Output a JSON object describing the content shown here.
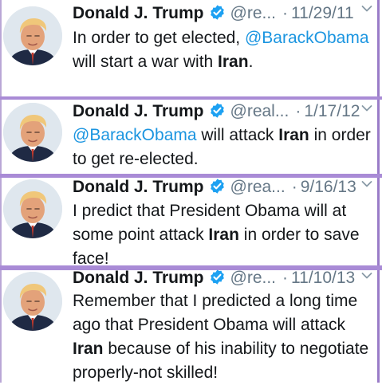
{
  "tweets": [
    {
      "name": "Donald J. Trump",
      "handle": "@re...",
      "date": "11/29/11",
      "text": [
        {
          "t": "In order to get elected, ",
          "s": "n"
        },
        {
          "t": "@BarackObama",
          "s": "m"
        },
        {
          "t": " will start a war with ",
          "s": "n"
        },
        {
          "t": "Iran",
          "s": "b"
        },
        {
          "t": ".",
          "s": "n"
        }
      ]
    },
    {
      "name": "Donald J. Trump",
      "handle": "@real...",
      "date": "1/17/12",
      "text": [
        {
          "t": "@BarackObama",
          "s": "m"
        },
        {
          "t": " will attack ",
          "s": "n"
        },
        {
          "t": "Iran",
          "s": "b"
        },
        {
          "t": " in order to get re-elected.",
          "s": "n"
        }
      ]
    },
    {
      "name": "Donald J. Trump",
      "handle": "@rea...",
      "date": "9/16/13",
      "text": [
        {
          "t": "I predict that President Obama will at some point attack ",
          "s": "n"
        },
        {
          "t": "Iran",
          "s": "b"
        },
        {
          "t": " in order to save face!",
          "s": "n"
        }
      ]
    },
    {
      "name": "Donald J. Trump",
      "handle": "@re...",
      "date": "11/10/13",
      "text": [
        {
          "t": "Remember that I predicted a long time ago that President Obama will attack ",
          "s": "n"
        },
        {
          "t": "Iran",
          "s": "b"
        },
        {
          "t": " because of his inability to negotiate properly-not skilled!",
          "s": "n"
        }
      ]
    }
  ],
  "icons": {
    "verified": "verified-badge-icon",
    "menu": "chevron-down-icon",
    "avatar": "profile-photo"
  },
  "colors": {
    "mention": "#1b95e0",
    "muted": "#657786",
    "verified": "#1da1f2",
    "separator": "#a98bd6"
  }
}
